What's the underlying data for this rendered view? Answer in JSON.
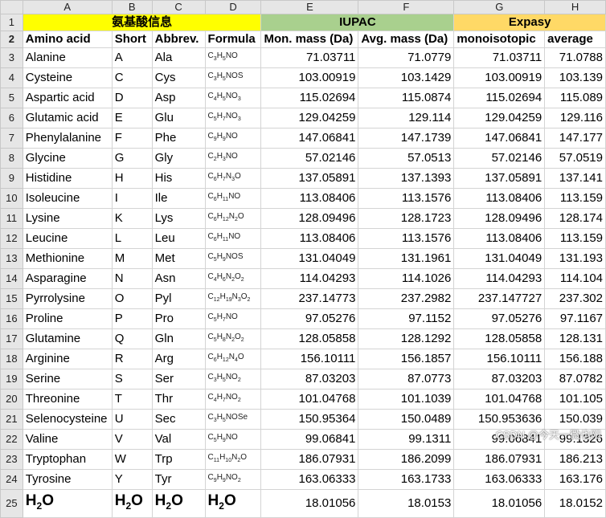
{
  "columns": [
    "A",
    "B",
    "C",
    "D",
    "E",
    "F",
    "G",
    "H"
  ],
  "group_headers": {
    "chinese": "氨基酸信息",
    "iupac": "IUPAC",
    "expasy": "Expasy"
  },
  "field_headers": [
    "Amino acid",
    "Short",
    "Abbrev.",
    "Formula",
    "Mon. mass (Da)",
    "Avg. mass (Da)",
    "monoisotopic",
    "average"
  ],
  "rows": [
    {
      "name": "Alanine",
      "short": "A",
      "abbrev": "Ala",
      "formula": "C3H5NO",
      "iupac_mono": "71.03711",
      "iupac_avg": "71.0779",
      "expasy_mono": "71.03711",
      "expasy_avg": "71.0788"
    },
    {
      "name": "Cysteine",
      "short": "C",
      "abbrev": "Cys",
      "formula": "C3H5NOS",
      "iupac_mono": "103.00919",
      "iupac_avg": "103.1429",
      "expasy_mono": "103.00919",
      "expasy_avg": "103.139"
    },
    {
      "name": "Aspartic acid",
      "short": "D",
      "abbrev": "Asp",
      "formula": "C4H5NO3",
      "iupac_mono": "115.02694",
      "iupac_avg": "115.0874",
      "expasy_mono": "115.02694",
      "expasy_avg": "115.089"
    },
    {
      "name": "Glutamic acid",
      "short": "E",
      "abbrev": "Glu",
      "formula": "C5H7NO3",
      "iupac_mono": "129.04259",
      "iupac_avg": "129.114",
      "expasy_mono": "129.04259",
      "expasy_avg": "129.116"
    },
    {
      "name": "Phenylalanine",
      "short": "F",
      "abbrev": "Phe",
      "formula": "C9H9NO",
      "iupac_mono": "147.06841",
      "iupac_avg": "147.1739",
      "expasy_mono": "147.06841",
      "expasy_avg": "147.177"
    },
    {
      "name": "Glycine",
      "short": "G",
      "abbrev": "Gly",
      "formula": "C2H3NO",
      "iupac_mono": "57.02146",
      "iupac_avg": "57.0513",
      "expasy_mono": "57.02146",
      "expasy_avg": "57.0519"
    },
    {
      "name": "Histidine",
      "short": "H",
      "abbrev": "His",
      "formula": "C6H7N3O",
      "iupac_mono": "137.05891",
      "iupac_avg": "137.1393",
      "expasy_mono": "137.05891",
      "expasy_avg": "137.141"
    },
    {
      "name": "Isoleucine",
      "short": "I",
      "abbrev": "Ile",
      "formula": "C6H11NO",
      "iupac_mono": "113.08406",
      "iupac_avg": "113.1576",
      "expasy_mono": "113.08406",
      "expasy_avg": "113.159"
    },
    {
      "name": "Lysine",
      "short": "K",
      "abbrev": "Lys",
      "formula": "C6H12N2O",
      "iupac_mono": "128.09496",
      "iupac_avg": "128.1723",
      "expasy_mono": "128.09496",
      "expasy_avg": "128.174"
    },
    {
      "name": "Leucine",
      "short": "L",
      "abbrev": "Leu",
      "formula": "C6H11NO",
      "iupac_mono": "113.08406",
      "iupac_avg": "113.1576",
      "expasy_mono": "113.08406",
      "expasy_avg": "113.159"
    },
    {
      "name": "Methionine",
      "short": "M",
      "abbrev": "Met",
      "formula": "C5H9NOS",
      "iupac_mono": "131.04049",
      "iupac_avg": "131.1961",
      "expasy_mono": "131.04049",
      "expasy_avg": "131.193"
    },
    {
      "name": "Asparagine",
      "short": "N",
      "abbrev": "Asn",
      "formula": "C4H6N2O2",
      "iupac_mono": "114.04293",
      "iupac_avg": "114.1026",
      "expasy_mono": "114.04293",
      "expasy_avg": "114.104"
    },
    {
      "name": "Pyrrolysine",
      "short": "O",
      "abbrev": "Pyl",
      "formula": "C12H19N3O2",
      "iupac_mono": "237.14773",
      "iupac_avg": "237.2982",
      "expasy_mono": "237.147727",
      "expasy_avg": "237.302"
    },
    {
      "name": "Proline",
      "short": "P",
      "abbrev": "Pro",
      "formula": "C5H7NO",
      "iupac_mono": "97.05276",
      "iupac_avg": "97.1152",
      "expasy_mono": "97.05276",
      "expasy_avg": "97.1167"
    },
    {
      "name": "Glutamine",
      "short": "Q",
      "abbrev": "Gln",
      "formula": "C5H8N2O2",
      "iupac_mono": "128.05858",
      "iupac_avg": "128.1292",
      "expasy_mono": "128.05858",
      "expasy_avg": "128.131"
    },
    {
      "name": "Arginine",
      "short": "R",
      "abbrev": "Arg",
      "formula": "C6H12N4O",
      "iupac_mono": "156.10111",
      "iupac_avg": "156.1857",
      "expasy_mono": "156.10111",
      "expasy_avg": "156.188"
    },
    {
      "name": "Serine",
      "short": "S",
      "abbrev": "Ser",
      "formula": "C3H5NO2",
      "iupac_mono": "87.03203",
      "iupac_avg": "87.0773",
      "expasy_mono": "87.03203",
      "expasy_avg": "87.0782"
    },
    {
      "name": "Threonine",
      "short": "T",
      "abbrev": "Thr",
      "formula": "C4H7NO2",
      "iupac_mono": "101.04768",
      "iupac_avg": "101.1039",
      "expasy_mono": "101.04768",
      "expasy_avg": "101.105"
    },
    {
      "name": "Selenocysteine",
      "short": "U",
      "abbrev": "Sec",
      "formula": "C3H5NOSe",
      "iupac_mono": "150.95364",
      "iupac_avg": "150.0489",
      "expasy_mono": "150.953636",
      "expasy_avg": "150.039"
    },
    {
      "name": "Valine",
      "short": "V",
      "abbrev": "Val",
      "formula": "C5H9NO",
      "iupac_mono": "99.06841",
      "iupac_avg": "99.1311",
      "expasy_mono": "99.06841",
      "expasy_avg": "99.1326"
    },
    {
      "name": "Tryptophan",
      "short": "W",
      "abbrev": "Trp",
      "formula": "C11H10N2O",
      "iupac_mono": "186.07931",
      "iupac_avg": "186.2099",
      "expasy_mono": "186.07931",
      "expasy_avg": "186.213"
    },
    {
      "name": "Tyrosine",
      "short": "Y",
      "abbrev": "Tyr",
      "formula": "C9H9NO2",
      "iupac_mono": "163.06333",
      "iupac_avg": "163.1733",
      "expasy_mono": "163.06333",
      "expasy_avg": "163.176"
    }
  ],
  "water": {
    "label": "H2O",
    "iupac_mono": "18.01056",
    "iupac_avg": "18.0153",
    "expasy_mono": "18.01056",
    "expasy_avg": "18.0152"
  },
  "watermark": "CSDN @今天一微也阳"
}
